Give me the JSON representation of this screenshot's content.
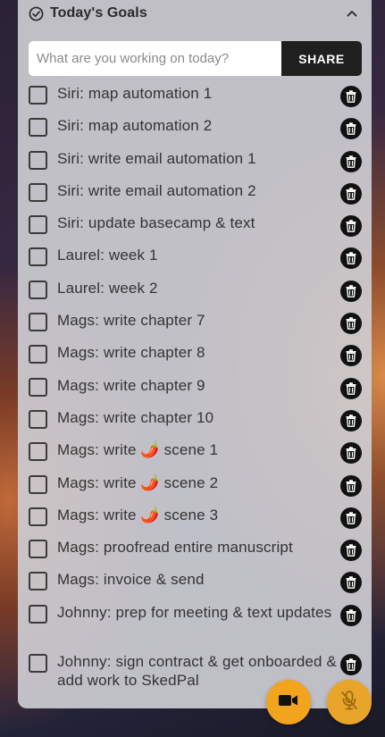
{
  "header": {
    "title": "Today's Goals"
  },
  "input": {
    "placeholder": "What are you working on today?",
    "value": "",
    "share_label": "SHARE"
  },
  "items": [
    {
      "label": "Siri: map automation 1"
    },
    {
      "label": "Siri: map automation 2"
    },
    {
      "label": "Siri: write email automation 1"
    },
    {
      "label": "Siri: write email automation 2"
    },
    {
      "label": "Siri: update basecamp & text"
    },
    {
      "label": "Laurel: week 1"
    },
    {
      "label": "Laurel: week 2"
    },
    {
      "label": "Mags: write chapter 7"
    },
    {
      "label": "Mags: write chapter 8"
    },
    {
      "label": "Mags: write chapter 9"
    },
    {
      "label": "Mags: write chapter 10"
    },
    {
      "label": "Mags: write 🌶️ scene 1"
    },
    {
      "label": "Mags: write 🌶️ scene 2"
    },
    {
      "label": "Mags: write 🌶️ scene 3"
    },
    {
      "label": "Mags: proofread entire manuscript"
    },
    {
      "label": "Mags: invoice & send"
    },
    {
      "label": "Johnny: prep for meeting & text updates"
    },
    {
      "label": "Johnny: sign contract & get onboarded & add work to SkedPal"
    }
  ],
  "icons": {
    "header": "check-circle-icon",
    "collapse": "chevron-up-icon",
    "delete": "trash-icon",
    "camera": "video-camera-icon",
    "mic": "microphone-muted-icon"
  },
  "colors": {
    "accent": "#f1a41c",
    "share_bg": "#1f1f1f",
    "panel": "#cdcdd2"
  }
}
